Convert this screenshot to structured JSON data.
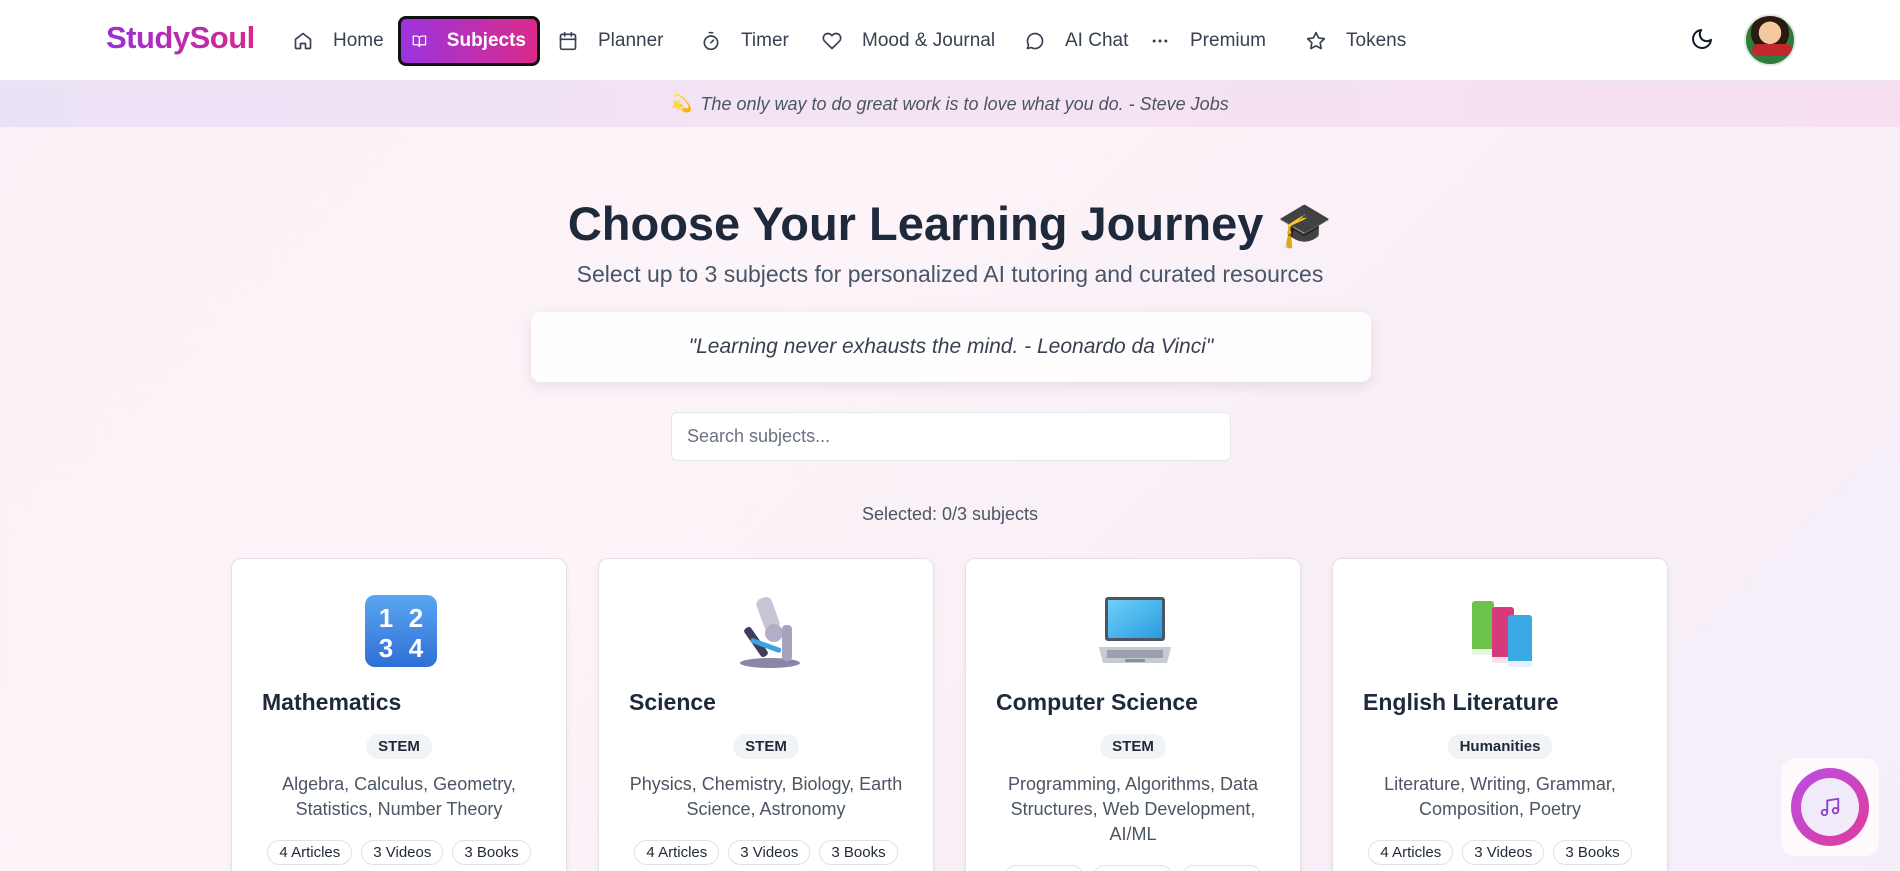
{
  "app": {
    "logo": "StudySoul"
  },
  "nav": {
    "items": [
      {
        "label": "Home",
        "icon": "home-icon"
      },
      {
        "label": "Subjects",
        "icon": "book-open-icon",
        "active": true
      },
      {
        "label": "Planner",
        "icon": "calendar-icon"
      },
      {
        "label": "Timer",
        "icon": "timer-icon"
      },
      {
        "label": "Mood & Journal",
        "icon": "heart-icon"
      },
      {
        "label": "AI Chat",
        "icon": "chat-bubble-icon"
      },
      {
        "label": "Premium",
        "icon": "more-dots-icon"
      },
      {
        "label": "Tokens",
        "icon": "star-icon"
      }
    ]
  },
  "banner": {
    "emoji": "💫",
    "quote": "The only way to do great work is to love what you do. - Steve Jobs"
  },
  "main": {
    "title": "Choose Your Learning Journey",
    "title_emoji": "🎓",
    "subtitle": "Select up to 3 subjects for personalized AI tutoring and curated resources",
    "quote": "\"Learning never exhausts the mind. - Leonardo da Vinci\"",
    "search_placeholder": "Search subjects...",
    "selected_text": "Selected: 0/3 subjects"
  },
  "subjects": [
    {
      "name": "Mathematics",
      "category": "STEM",
      "description": "Algebra, Calculus, Geometry, Statistics, Number Theory",
      "articles": "4 Articles",
      "videos": "3 Videos",
      "books": "3 Books",
      "icon": "numbers-1234-icon"
    },
    {
      "name": "Science",
      "category": "STEM",
      "description": "Physics, Chemistry, Biology, Earth Science, Astronomy",
      "articles": "4 Articles",
      "videos": "3 Videos",
      "books": "3 Books",
      "icon": "microscope-icon"
    },
    {
      "name": "Computer Science",
      "category": "STEM",
      "description": "Programming, Algorithms, Data Structures, Web Development, AI/ML",
      "articles": "",
      "videos": "",
      "books": "",
      "icon": "laptop-icon"
    },
    {
      "name": "English Literature",
      "category": "Humanities",
      "description": "Literature, Writing, Grammar, Composition, Poetry",
      "articles": "4 Articles",
      "videos": "3 Videos",
      "books": "3 Books",
      "icon": "books-icon"
    }
  ],
  "colors": {
    "brand_start": "#9a34e0",
    "brand_end": "#dc2a88",
    "heading": "#1e293b"
  }
}
